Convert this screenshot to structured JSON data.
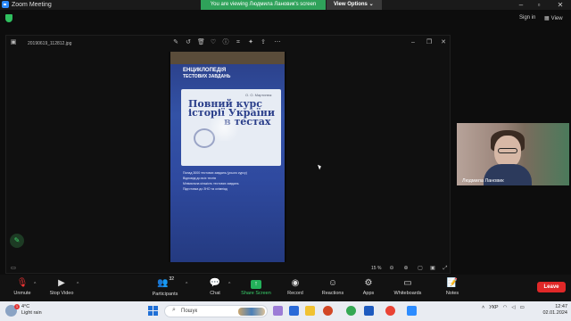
{
  "window": {
    "title": "Zoom Meeting",
    "banner_text": "You are viewing Людмила Лановик's screen",
    "view_options_label": "View Options",
    "sign_in_label": "Sign in",
    "view_label": "View"
  },
  "viewer": {
    "filename": "20190619_112812.jpg",
    "zoom_level": "15 %",
    "toolbar_icons": [
      "edit-icon",
      "rotate-icon",
      "delete-icon",
      "favorite-icon",
      "info-icon",
      "crop-icon",
      "edit-photo-icon",
      "share-icon",
      "more-icon"
    ],
    "book": {
      "header_line1": "ЕНЦИКЛОПЕДІЯ",
      "header_line2": "ТЕСТОВИХ ЗАВДАНЬ",
      "author": "О. О. Мартинюк",
      "title_line1": "Повний курс",
      "title_line2": "історії України",
      "title_line3": "в тестах",
      "list": [
        "Понад 3000 тестових завдань (усього курсу)",
        "Відповіді до всіх тестів",
        "Мінімальна кількість тестових завдань",
        "Підготовка до ЗНО та олімпіад"
      ]
    }
  },
  "participant": {
    "name": "Людмила Лановик"
  },
  "toolbar": {
    "unmute_label": "Unmute",
    "stop_video_label": "Stop Video",
    "participants_label": "Participants",
    "participants_count": "32",
    "chat_label": "Chat",
    "share_screen_label": "Share Screen",
    "record_label": "Record",
    "reactions_label": "Reactions",
    "apps_label": "Apps",
    "whiteboards_label": "Whiteboards",
    "notes_label": "Notes",
    "leave_label": "Leave"
  },
  "taskbar": {
    "weather_temp": "4°C",
    "weather_desc": "Light rain",
    "weather_badge": "1",
    "search_placeholder": "Пошук",
    "language": "УКР",
    "time": "12:47",
    "date": "02.01.2024"
  },
  "colors": {
    "accent_green": "#2fa25a",
    "leave_red": "#e02828",
    "zoom_blue": "#2d8cff"
  }
}
